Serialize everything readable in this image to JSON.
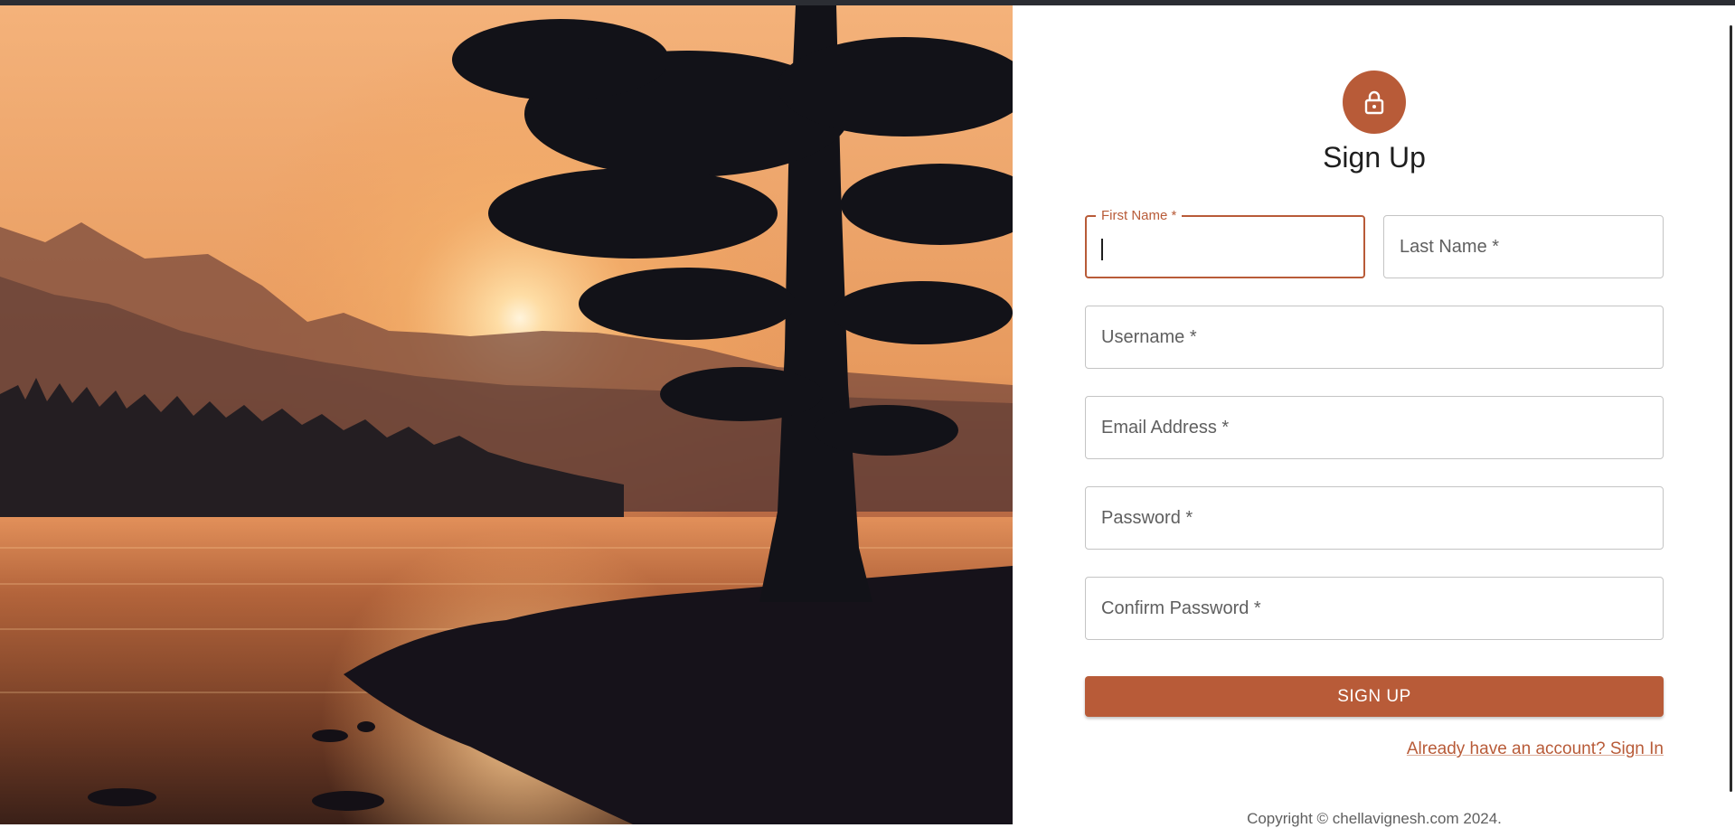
{
  "hero_image": {
    "description_icon": "sunset-lake-photo",
    "colors": {
      "sky_top": "#d88a52",
      "sky_glow": "#f6c98e",
      "water": "#6b3b25",
      "silhouette": "#121218"
    }
  },
  "form": {
    "icon": "lock-icon",
    "title": "Sign Up",
    "fields": {
      "first_name": {
        "label": "First Name *",
        "value": ""
      },
      "last_name": {
        "label": "Last Name *",
        "value": ""
      },
      "username": {
        "label": "Username *",
        "value": ""
      },
      "email": {
        "label": "Email Address *",
        "value": ""
      },
      "password": {
        "label": "Password *",
        "value": ""
      },
      "confirm_password": {
        "label": "Confirm Password *",
        "value": ""
      }
    },
    "submit_label": "SIGN UP",
    "signin_link": "Already have an account? Sign In",
    "copyright": "Copyright © chellavignesh.com 2024."
  },
  "theme": {
    "accent": "#b85b38",
    "border": "#c4c4c4",
    "text": "#1e1e1e"
  }
}
